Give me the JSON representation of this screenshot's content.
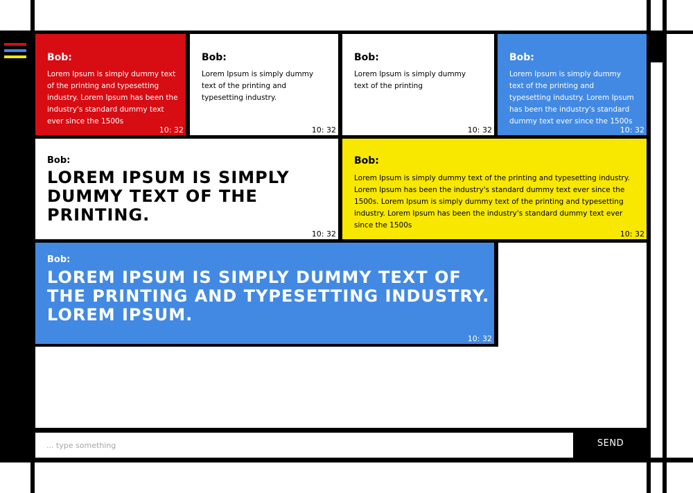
{
  "theme": {
    "red": "#d80c13",
    "blue": "#4289e3",
    "yellow": "#f8e800",
    "white": "#ffffff",
    "black": "#000000"
  },
  "menu": {
    "icon": "hamburger-menu-icon",
    "bar_colors": [
      "#d80c13",
      "#4289e3",
      "#f8e800"
    ]
  },
  "messages": [
    {
      "sender": "Bob:",
      "text": "Lorem Ipsum is simply dummy text of the printing and typesetting industry. Lorem Ipsum has been the industry's standard dummy text ever since the 1500s",
      "time": "10: 32",
      "color": "red"
    },
    {
      "sender": "Bob:",
      "text": "Lorem Ipsum is simply dummy text of the printing and typesetting industry.",
      "time": "10: 32",
      "color": "white"
    },
    {
      "sender": "Bob:",
      "text": "Lorem Ipsum is simply dummy text of the printing",
      "time": "10: 32",
      "color": "white"
    },
    {
      "sender": "Bob:",
      "text": "Lorem Ipsum is simply dummy text of the printing and typesetting industry. Lorem Ipsum has been the industry's standard dummy text ever since the 1500s",
      "time": "10: 32",
      "color": "blue"
    },
    {
      "sender": "Bob:",
      "text": "Lorem Ipsum is simply dummy text of the printing.",
      "time": "10: 32",
      "color": "white"
    },
    {
      "sender": "Bob:",
      "text": "Lorem Ipsum is simply dummy text of the printing and typesetting industry. Lorem Ipsum has been the industry's standard dummy text ever since the 1500s. Lorem Ipsum is simply dummy text of the printing and typesetting industry. Lorem Ipsum has been the industry's standard dummy text ever since the 1500s",
      "time": "10: 32",
      "color": "yellow"
    },
    {
      "sender": "Bob:",
      "text": "Lorem Ipsum is simply dummy text of the printing and typesetting industry. Lorem Ipsum.",
      "time": "10: 32",
      "color": "blue"
    }
  ],
  "composer": {
    "placeholder": "... type something",
    "value": "",
    "send_label": "SEND"
  }
}
